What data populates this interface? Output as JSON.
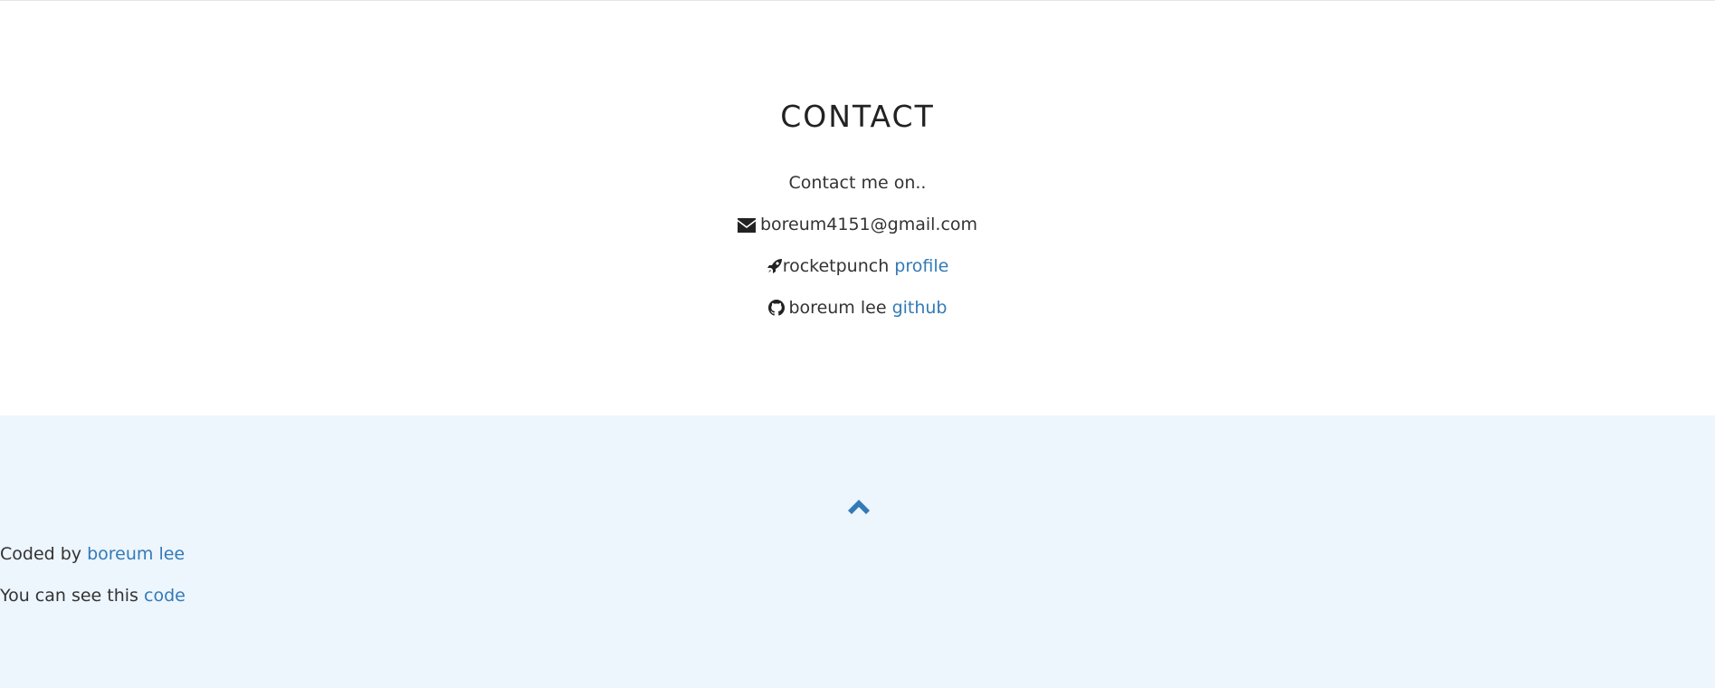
{
  "contact": {
    "title": "CONTACT",
    "intro": "Contact me on..",
    "email": {
      "icon": "envelope-icon",
      "address": "boreum4151@gmail.com"
    },
    "rocketpunch": {
      "icon": "rocket-icon",
      "text": "rocketpunch ",
      "link_label": "profile"
    },
    "github": {
      "icon": "github-icon",
      "text": "boreum lee ",
      "link_label": "github"
    }
  },
  "footer": {
    "up_icon": "chevron-up-icon",
    "coded_prefix": "Coded by ",
    "coded_link": "boreum lee",
    "source_prefix": "You can see this ",
    "source_link": "code"
  },
  "colors": {
    "link": "#337ab7",
    "footer_bg": "#edf5fd",
    "text": "#333333"
  }
}
